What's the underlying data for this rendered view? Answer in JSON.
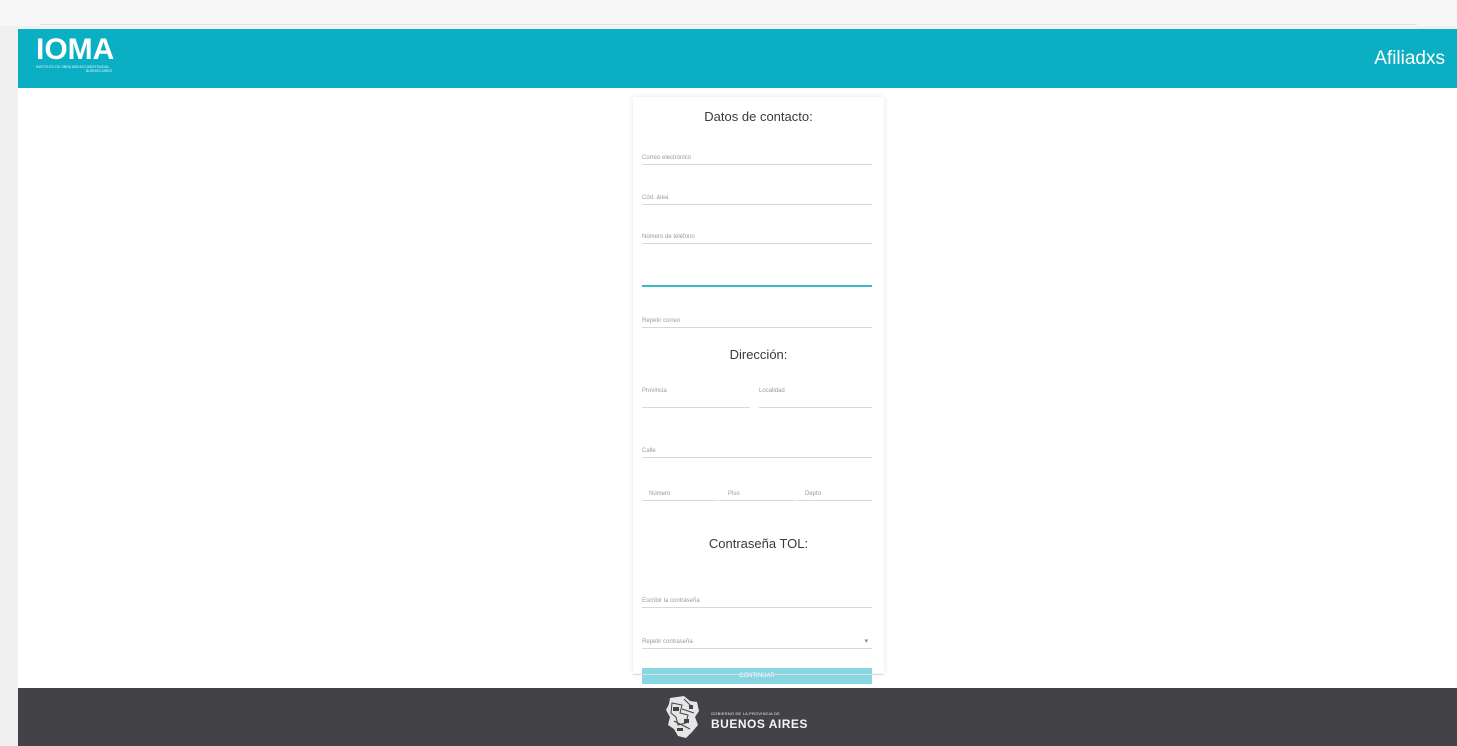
{
  "header": {
    "logo_text": "IOMA",
    "logo_subtitle": "INSTITUTO DE OBRA MEDICO ASISTENCIAL",
    "logo_subtitle2": "BUENOS AIRES",
    "title": "Afiliadxs"
  },
  "form": {
    "contact": {
      "title": "Datos de contacto:",
      "fields": [
        "Correo electrónico",
        "Cód. área",
        "Número de teléfono",
        "",
        "Repetir correo"
      ]
    },
    "address": {
      "title": "Dirección:",
      "provincia": "Provincia",
      "localidad": "Localidad",
      "calle": "Calle",
      "numero": "Número",
      "piso": "Piso",
      "depto": "Depto"
    },
    "password": {
      "title": "Contraseña TOL:",
      "fields": [
        "Escribir la contraseña",
        "Repetir contraseña"
      ],
      "caret": "▾"
    },
    "submit_label": "CONTINUAR"
  },
  "footer": {
    "small_text": "GOBIERNO DE LA PROVINCIA DE",
    "big_text": "BUENOS AIRES",
    "emblem_icon": "province-map-icon"
  },
  "colors": {
    "header": "#0aafc4",
    "footer": "#434347",
    "button": "#88d6e1",
    "active_line": "#3eb9cc"
  }
}
